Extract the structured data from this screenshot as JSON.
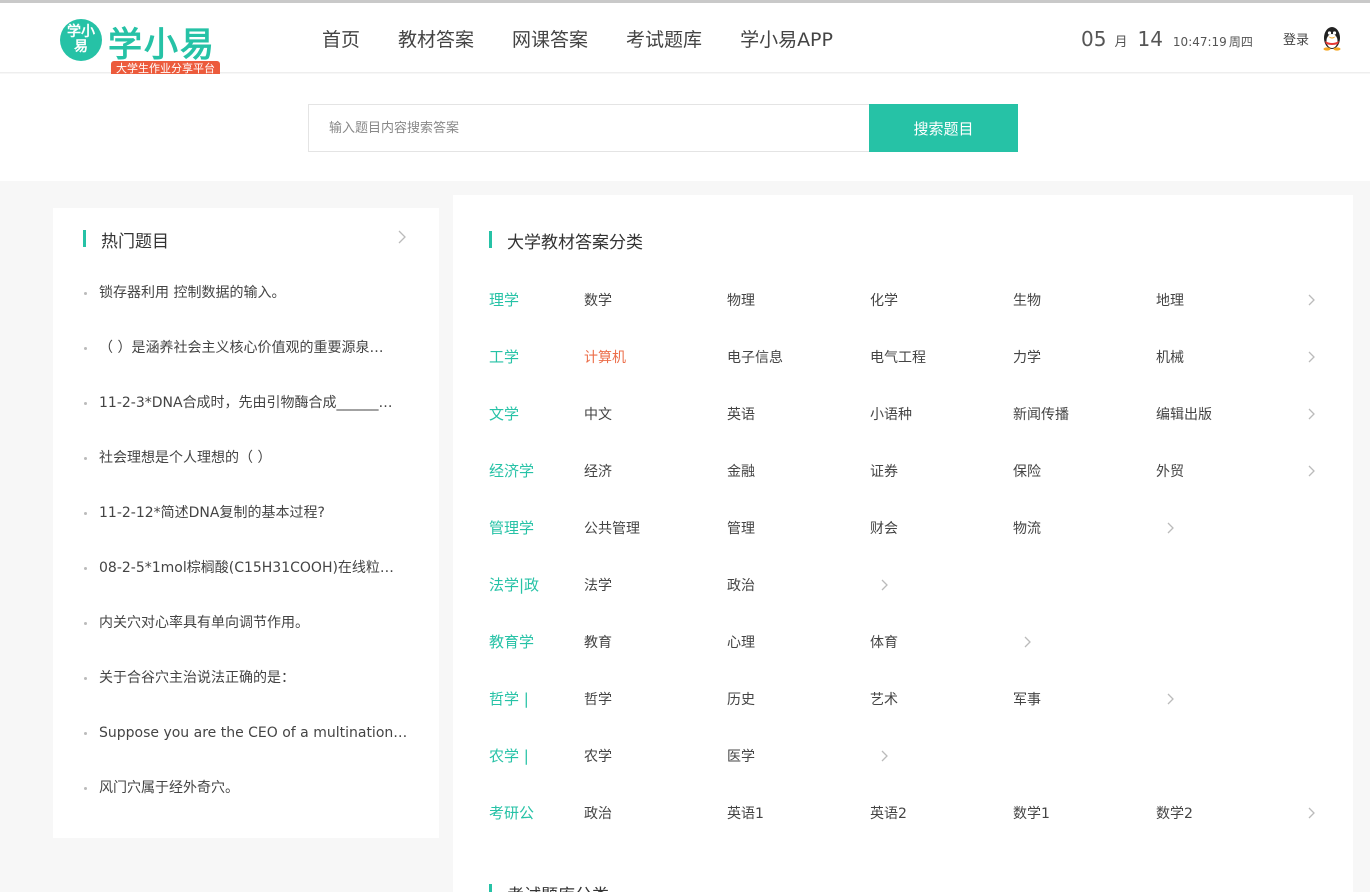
{
  "header": {
    "logo": {
      "badge_text": "学小易",
      "name": "学小易",
      "tagline": "大学生作业分享平台",
      "brand_color": "#26c2a6",
      "tag_color": "#ec5b3c"
    },
    "nav": [
      "首页",
      "教材答案",
      "网课答案",
      "考试题库",
      "学小易APP"
    ],
    "date": {
      "month": "05",
      "month_unit": "月",
      "day": "14",
      "time": "10:47:19",
      "weekday": "周四"
    },
    "login_label": "登录",
    "login_icon": "qq-penguin-icon"
  },
  "search": {
    "placeholder": "输入题目内容搜索答案",
    "button_label": "搜索题目"
  },
  "hot": {
    "title": "热门题目",
    "items": [
      "锁存器利用 控制数据的输入。",
      "（ ）是涵养社会主义核心价值观的重要源泉…",
      "11-2-3*DNA合成时，先由引物酶合成______…",
      "社会理想是个人理想的（ ）",
      "11-2-12*简述DNA复制的基本过程?",
      "08-2-5*1mol棕榈酸(C15H31COOH)在线粒…",
      "内关穴对心率具有单向调节作用。",
      "关于合谷穴主治说法正确的是：",
      "Suppose you are the CEO of a multinational…",
      "风门穴属于经外奇穴。"
    ]
  },
  "categories": {
    "title": "大学教材答案分类",
    "section2_title": "考试题库分类",
    "active_color": "#ec6e4a",
    "rows": [
      {
        "name": "理学",
        "subs": [
          "数学",
          "物理",
          "化学",
          "生物",
          "地理"
        ]
      },
      {
        "name": "工学",
        "subs": [
          "计算机",
          "电子信息",
          "电气工程",
          "力学",
          "机械"
        ],
        "active": 0
      },
      {
        "name": "文学",
        "subs": [
          "中文",
          "英语",
          "小语种",
          "新闻传播",
          "编辑出版"
        ]
      },
      {
        "name": "经济学",
        "subs": [
          "经济",
          "金融",
          "证券",
          "保险",
          "外贸"
        ]
      },
      {
        "name": "管理学",
        "subs": [
          "公共管理",
          "管理",
          "财会",
          "物流"
        ]
      },
      {
        "name": "法学|政",
        "subs": [
          "法学",
          "政治"
        ]
      },
      {
        "name": "教育学",
        "subs": [
          "教育",
          "心理",
          "体育"
        ]
      },
      {
        "name": "哲学 |",
        "subs": [
          "哲学",
          "历史",
          "艺术",
          "军事"
        ]
      },
      {
        "name": "农学 |",
        "subs": [
          "农学",
          "医学"
        ]
      },
      {
        "name": "考研公",
        "subs": [
          "政治",
          "英语1",
          "英语2",
          "数学1",
          "数学2"
        ]
      }
    ]
  }
}
